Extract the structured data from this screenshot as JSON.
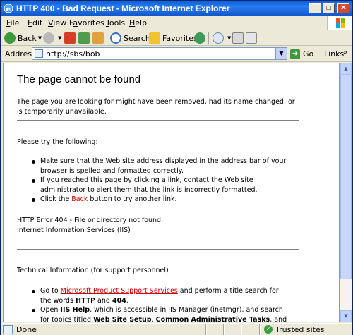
{
  "window": {
    "title": "HTTP 400 - Bad Request - Microsoft Internet Explorer",
    "controls": {
      "minimize": "_",
      "maximize": "□",
      "close": "✕"
    }
  },
  "menu": {
    "items": [
      {
        "pre": "",
        "accel": "F",
        "post": "ile"
      },
      {
        "pre": "",
        "accel": "E",
        "post": "dit"
      },
      {
        "pre": "",
        "accel": "V",
        "post": "iew"
      },
      {
        "pre": "F",
        "accel": "a",
        "post": "vorites"
      },
      {
        "pre": "",
        "accel": "T",
        "post": "ools"
      },
      {
        "pre": "",
        "accel": "H",
        "post": "elp"
      }
    ]
  },
  "toolbar": {
    "back_label": "Back",
    "search_label": "Search",
    "favorites_label": "Favorites",
    "icons": [
      "back-icon",
      "forward-icon",
      "stop-icon",
      "refresh-icon",
      "home-icon",
      "search-icon",
      "favorites-icon",
      "media-icon",
      "mail-icon",
      "print-icon",
      "edit-icon"
    ]
  },
  "address": {
    "label": "Address",
    "value": "http://sbs/bob",
    "go_label": "Go",
    "links_label": "Links",
    "chevron": "»"
  },
  "page": {
    "heading": "The page cannot be found",
    "intro": "The page you are looking for might have been removed, had its name changed, or is temporarily unavailable.",
    "try_heading": "Please try the following:",
    "bullets": {
      "b1": "Make sure that the Web site address displayed in the address bar of your browser is spelled and formatted correctly.",
      "b2": "If you reached this page by clicking a link, contact the Web site administrator to alert them that the link is incorrectly formatted.",
      "b3_pre": "Click the ",
      "b3_link": "Back",
      "b3_post": " button to try another link."
    },
    "error_line1": "HTTP Error 404 - File or directory not found.",
    "error_line2": "Internet Information Services (IIS)",
    "tech_heading": "Technical Information (for support personnel)",
    "tech": {
      "t1_pre": "Go to ",
      "t1_link": "Microsoft Product Support Services",
      "t1_mid": " and perform a title search for the words ",
      "t1_b1": "HTTP",
      "t1_and": " and ",
      "t1_b2": "404",
      "t1_end": ".",
      "t2_pre": "Open ",
      "t2_b1": "IIS Help",
      "t2_mid": ", which is accessible in IIS Manager (inetmgr), and search for topics titled ",
      "t2_b2": "Web Site Setup",
      "t2_sep": ", ",
      "t2_b3": "Common Administrative Tasks",
      "t2_end": ", and"
    }
  },
  "status": {
    "text": "Done",
    "zone": "Trusted sites"
  },
  "colors": {
    "titlebar": "#0a5fd8",
    "link": "#cc0000",
    "frame": "#ece9d8"
  }
}
